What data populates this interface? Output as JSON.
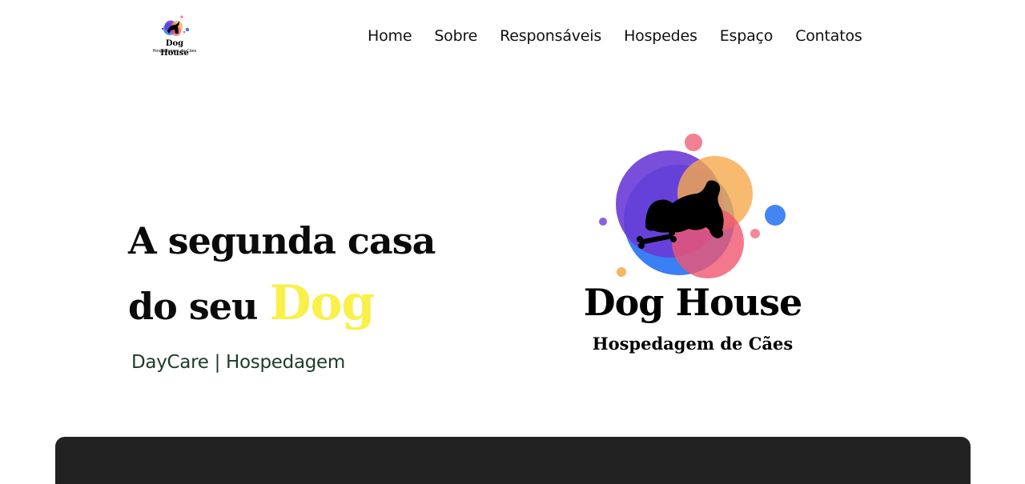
{
  "header": {
    "logo": {
      "title": "Dog House",
      "subtitle": "Hospedagem de Cães"
    },
    "nav": [
      {
        "label": "Home"
      },
      {
        "label": "Sobre"
      },
      {
        "label": "Responsáveis"
      },
      {
        "label": "Hospedes"
      },
      {
        "label": "Espaço"
      },
      {
        "label": "Contatos"
      }
    ]
  },
  "hero": {
    "headline_line1": "A segunda casa",
    "headline_line2_prefix": "do seu ",
    "headline_accent": "Dog",
    "subline": "DayCare | Hospedagem",
    "logo": {
      "title": "Dog House",
      "subtitle": "Hospedagem de Cães"
    }
  },
  "colors": {
    "accent_yellow": "#f9f04a",
    "purple": "#6a3bd6",
    "blue": "#2f78f2",
    "orange": "#f6a94b",
    "pink": "#f0566f",
    "dark_panel": "#222222",
    "subline_green": "#1e3b2a"
  }
}
